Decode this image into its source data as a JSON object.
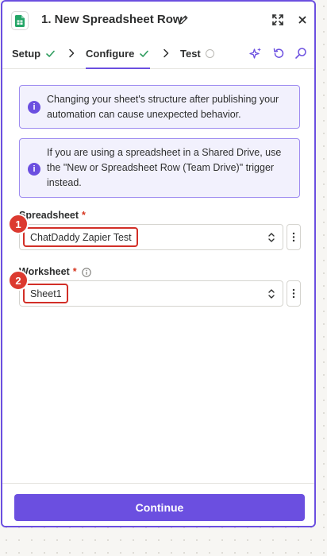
{
  "header": {
    "title": "1. New Spreadsheet Row",
    "app_icon": "google-sheets-icon",
    "actions": [
      "edit-icon",
      "expand-icon",
      "close-icon"
    ]
  },
  "tabs": [
    {
      "label": "Setup",
      "state": "complete"
    },
    {
      "label": "Configure",
      "state": "complete",
      "active": true
    },
    {
      "label": "Test",
      "state": "pending"
    }
  ],
  "tools": [
    "sparkle-icon",
    "undo-icon",
    "search-icon"
  ],
  "alerts": [
    {
      "text": "Changing your sheet's structure after publishing your automation can cause unexpected behavior."
    },
    {
      "text": "If you are using a spreadsheet in a Shared Drive, use the \"New or Spreadsheet Row (Team Drive)\" trigger instead."
    }
  ],
  "fields": {
    "spreadsheet": {
      "label": "Spreadsheet",
      "required_mark": "*",
      "value": "ChatDaddy Zapier Test",
      "badge": "1"
    },
    "worksheet": {
      "label": "Worksheet",
      "required_mark": "*",
      "value": "Sheet1",
      "badge": "2"
    }
  },
  "footer": {
    "continue_label": "Continue"
  },
  "colors": {
    "accent": "#6b4fe0",
    "badge": "#dc3a30",
    "highlight_border": "#d22f27",
    "success": "#2e9c5e"
  }
}
